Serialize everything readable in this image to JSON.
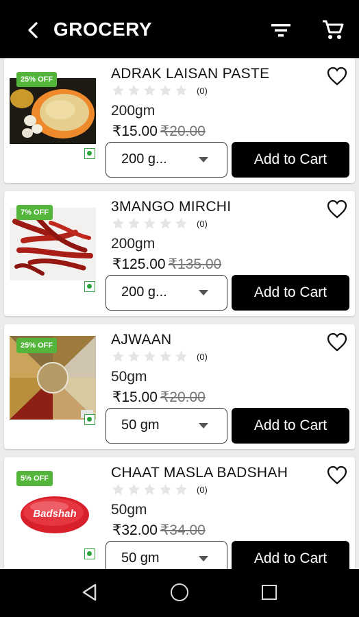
{
  "header": {
    "title": "GROCERY",
    "back_icon": "back-arrow-icon",
    "filter_icon": "filter-icon",
    "cart_icon": "cart-icon"
  },
  "colors": {
    "accent": "#000000",
    "badge": "#53b63b",
    "veg": "#2aa53a"
  },
  "products": [
    {
      "name": "ADRAK LAISAN PASTE",
      "badge": "25% OFF",
      "rating_count": "(0)",
      "weight": "200gm",
      "price": "₹15.00",
      "mrp": "₹20.00",
      "selected_size": "200 g...",
      "add_label": "Add to Cart"
    },
    {
      "name": "3MANGO MIRCHI",
      "badge": "7% OFF",
      "rating_count": "(0)",
      "weight": "200gm",
      "price": "₹125.00",
      "mrp": "₹135.00",
      "selected_size": "200 g...",
      "add_label": "Add to Cart"
    },
    {
      "name": "AJWAAN",
      "badge": "25% OFF",
      "rating_count": "(0)",
      "weight": "50gm",
      "price": "₹15.00",
      "mrp": "₹20.00",
      "selected_size": "50 gm",
      "add_label": "Add to Cart"
    },
    {
      "name": "CHAAT MASLA BADSHAH",
      "badge": "5% OFF",
      "rating_count": "(0)",
      "weight": "50gm",
      "price": "₹32.00",
      "mrp": "₹34.00",
      "selected_size": "50 gm",
      "add_label": "Add to Cart",
      "logo_text": "Badshah"
    }
  ],
  "navbar": {
    "back": "nav-back-icon",
    "home": "nav-home-icon",
    "recent": "nav-recent-icon"
  }
}
